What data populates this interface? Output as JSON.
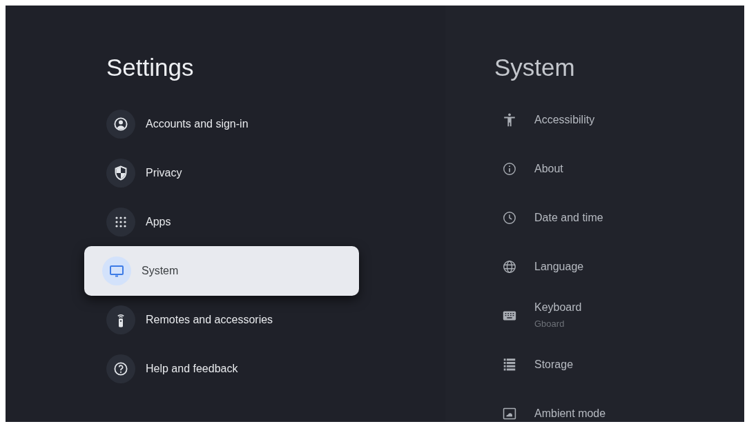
{
  "settings": {
    "title": "Settings",
    "items": [
      {
        "label": "Accounts and sign-in",
        "selected": false
      },
      {
        "label": "Privacy",
        "selected": false
      },
      {
        "label": "Apps",
        "selected": false
      },
      {
        "label": "System",
        "selected": true
      },
      {
        "label": "Remotes and accessories",
        "selected": false
      },
      {
        "label": "Help and feedback",
        "selected": false
      }
    ]
  },
  "system": {
    "title": "System",
    "items": [
      {
        "label": "Accessibility"
      },
      {
        "label": "About"
      },
      {
        "label": "Date and time"
      },
      {
        "label": "Language"
      },
      {
        "label": "Keyboard",
        "subtitle": "Gboard"
      },
      {
        "label": "Storage"
      },
      {
        "label": "Ambient mode"
      }
    ]
  }
}
